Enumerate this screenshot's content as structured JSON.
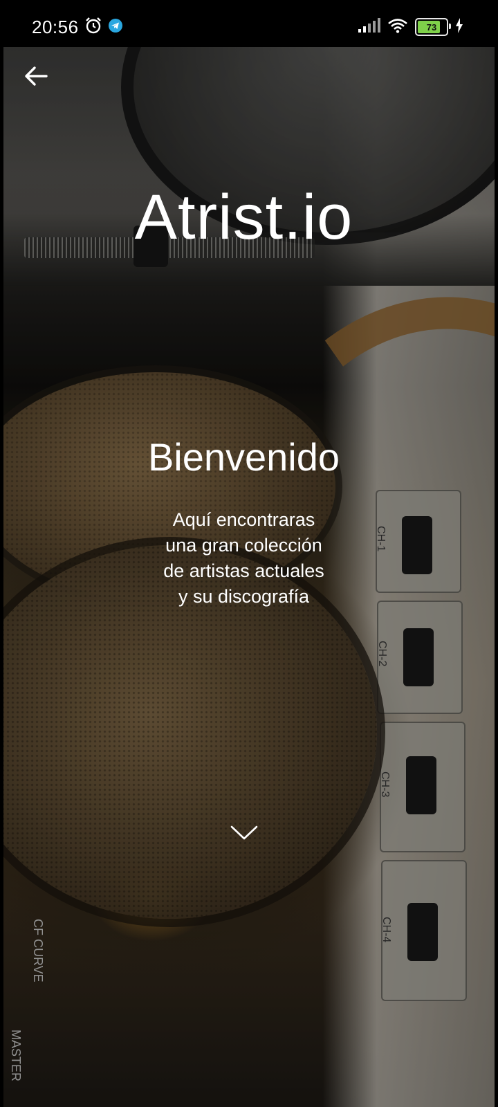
{
  "status_bar": {
    "time": "20:56",
    "battery": "73",
    "battery_level_percent": 73,
    "icons": [
      "alarm-icon",
      "telegram-icon",
      "signal-icon",
      "wifi-icon",
      "battery-icon",
      "charging-icon"
    ]
  },
  "app": {
    "title": "Atrist.io"
  },
  "welcome": {
    "title": "Bienvenido",
    "lines": [
      "Aquí encontraras",
      "una gran colección",
      "de artistas actuales",
      "y su discografía"
    ]
  },
  "mixer_labels": [
    "CH-1",
    "CH-2",
    "CH-3",
    "CH-4",
    "CF CURVE",
    "MASTER"
  ],
  "colors": {
    "text": "#ffffff",
    "background": "#000000",
    "battery": "#7fd14a",
    "telegram": "#2aa7e0"
  }
}
